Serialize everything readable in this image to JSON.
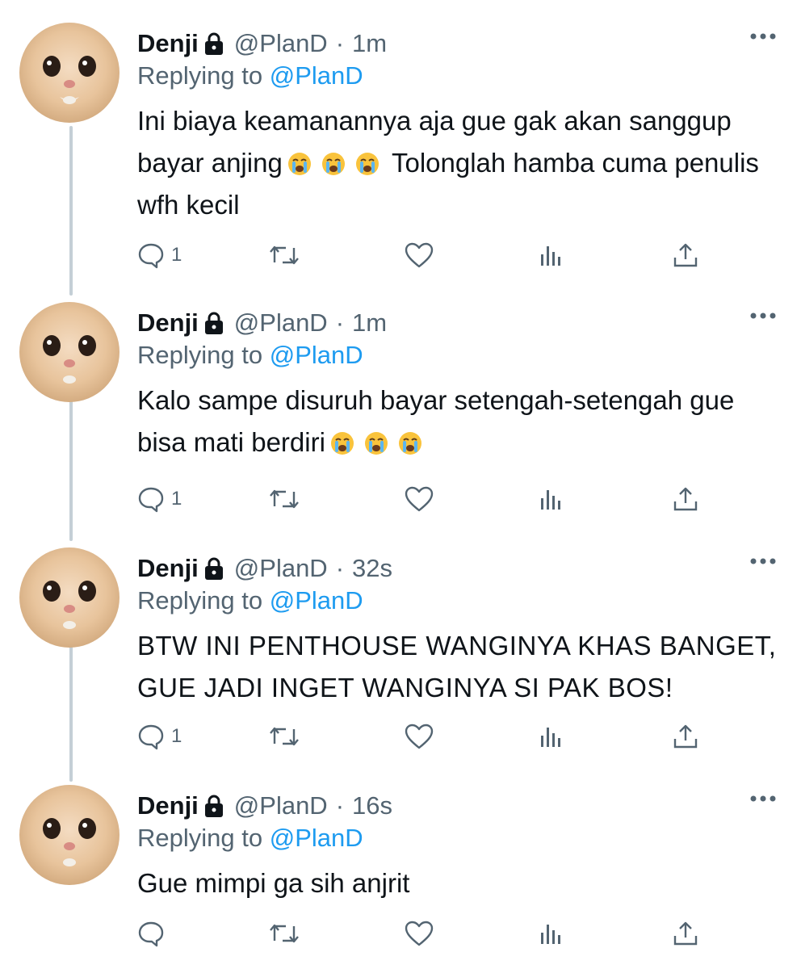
{
  "thread": {
    "tweets": [
      {
        "name": "Denji",
        "handle": "@PlanD",
        "time": "1m",
        "replying_prefix": "Replying to ",
        "replying_to": "@PlanD",
        "text_parts": [
          "Ini biaya keamanannya aja gue gak akan sanggup bayar anjing",
          "Tolonglah hamba cuma penulis wfh kecil"
        ],
        "reply_count": "1"
      },
      {
        "name": "Denji",
        "handle": "@PlanD",
        "time": "1m",
        "replying_prefix": "Replying to ",
        "replying_to": "@PlanD",
        "text_parts": [
          "Kalo sampe disuruh bayar setengah-setengah gue bisa mati berdiri"
        ],
        "reply_count": "1"
      },
      {
        "name": "Denji",
        "handle": "@PlanD",
        "time": "32s",
        "replying_prefix": "Replying to ",
        "replying_to": "@PlanD",
        "text_parts": [
          "BTW INI PENTHOUSE WANGINYA KHAS BANGET, GUE JADI INGET WANGINYA SI PAK BOS!"
        ],
        "reply_count": "1"
      },
      {
        "name": "Denji",
        "handle": "@PlanD",
        "time": "16s",
        "replying_prefix": "Replying to ",
        "replying_to": "@PlanD",
        "text_parts": [
          "Gue mimpi ga sih anjrit"
        ],
        "reply_count": ""
      }
    ]
  },
  "separator": "·",
  "icons": {
    "lock": "lock-icon",
    "more": "more-icon",
    "reply": "reply-icon",
    "retweet": "retweet-icon",
    "like": "heart-icon",
    "views": "views-icon",
    "share": "share-icon",
    "emoji": "loudly-crying-face-emoji"
  },
  "colors": {
    "text": "#0f1419",
    "muted": "#536471",
    "mention": "#1d9bf0",
    "thread_line": "#c4cfd6"
  }
}
